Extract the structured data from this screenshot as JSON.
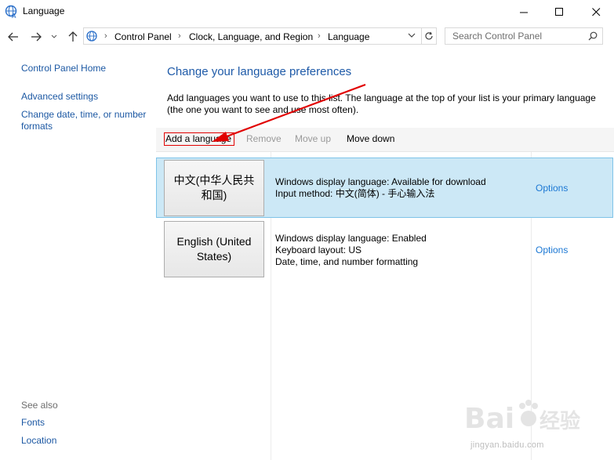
{
  "window": {
    "title": "Language",
    "minimize_icon": "minimize-icon",
    "maximize_icon": "maximize-icon",
    "close_icon": "close-icon"
  },
  "nav": {
    "breadcrumbs": [
      "Control Panel",
      "Clock, Language, and Region",
      "Language"
    ],
    "search_placeholder": "Search Control Panel"
  },
  "sidebar": {
    "links": [
      "Control Panel Home",
      "Advanced settings",
      "Change date, time, or number formats"
    ],
    "see_also_label": "See also",
    "see_also": [
      "Fonts",
      "Location"
    ]
  },
  "main": {
    "heading": "Change your language preferences",
    "description": "Add languages you want to use to this list. The language at the top of your list is your primary language (the one you want to see and use most often).",
    "toolbar": {
      "add": "Add a language",
      "remove": "Remove",
      "move_up": "Move up",
      "move_down": "Move down"
    },
    "languages": [
      {
        "name": "中文(中华人民共和国)",
        "details": [
          "Windows display language: Available for download",
          "Input method: 中文(简体) - 手心输入法"
        ],
        "options": "Options",
        "selected": true
      },
      {
        "name": "English (United States)",
        "details": [
          "Windows display language: Enabled",
          "Keyboard layout: US",
          "Date, time, and number formatting"
        ],
        "options": "Options",
        "selected": false
      }
    ]
  },
  "watermark": {
    "logo_text": "Bai du 经验",
    "url": "jingyan.baidu.com"
  },
  "colors": {
    "accent_link": "#1c58a3",
    "heading": "#1e5aa8",
    "selection": "#cce8f6",
    "annotation": "#e10000"
  }
}
